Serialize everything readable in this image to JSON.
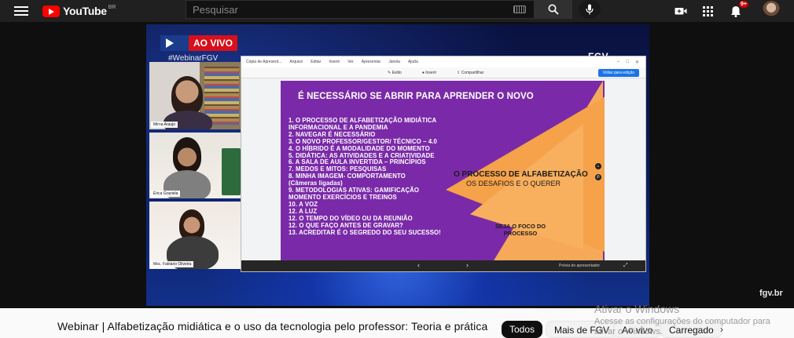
{
  "topbar": {
    "logo_text": "YouTube",
    "country": "BR",
    "search_placeholder": "Pesquisar",
    "notif_count": "9+"
  },
  "video": {
    "live_label": "AO VIVO",
    "hashtag": "#WebinarFGV",
    "brand": "FGV",
    "watermark_corner": "fgv.br",
    "participants": [
      {
        "name": "Mirna Araujo"
      },
      {
        "name": "Érica Graziela"
      },
      {
        "name": "Msc. Fabiano Oliveira"
      }
    ],
    "slides_window": {
      "menu": [
        "Cópia de Apresent...",
        "Arquivo",
        "Editar",
        "Inserir",
        "Ver",
        "Apresentar",
        "Janela",
        "Ajuda"
      ],
      "toolbar": [
        "Estilo",
        "Inserir",
        "Compartilhar"
      ],
      "share_button": "Voltar para edição",
      "footer_label": "Prévia do apresentador"
    },
    "slide": {
      "title": "É NECESSÁRIO SE ABRIR PARA APRENDER O NOVO",
      "items": [
        "1. O PROCESSO DE ALFABETIZAÇÃO MIDIÁTICA",
        "INFORMACIONAL E A PANDEMIA",
        "2. NAVEGAR É NECESSÁRIO",
        "3. O NOVO PROFESSOR/GESTOR/ TÉCNICO – 4.0",
        "4. O HÍBRIDO É A MODALIDADE DO MOMENTO",
        "5. DIDÁTICA: AS ATIVIDADES E A CRIATIVIDADE",
        "6. A SALA DE AULA INVERTIDA – PRINCÍPIOS",
        "7. MEDOS E MITOS: PESQUISAS",
        "8. MINHA IMAGEM- COMPORTAMENTO",
        "(Câmeras ligadas)",
        "9. METODOLOGIAS ATIVAS: GAMIFICAÇÃO",
        "MOMENTO EXERCÍCIOS E TREINOS",
        "10. A VOZ",
        "12. A LUZ",
        "12. O TEMPO DO VÍDEO OU DA REUNIÃO",
        "12. O QUE FAÇO ANTES DE GRAVAR?",
        "13. ACREDITAR É O SEGREDO DO SEU SUCESSO!"
      ],
      "center_title": "O PROCESSO DE ALFABETIZAÇÃO",
      "center_subtitle": "OS DESAFIOS E O QUERER",
      "focus_line1": "SEJA O FOCO DO",
      "focus_line2": "PROCESSO"
    }
  },
  "below": {
    "title": "Webinar | Alfabetização midiática e o uso da tecnologia pelo professor: Teoria e prática",
    "chips": [
      "Todos",
      "Mais de FGV",
      "Ao vivo",
      "Carregado"
    ]
  },
  "windows_watermark": {
    "line1": "Ativar o Windows",
    "line2": "Acesse as configurações do computador para ativar o Windows."
  },
  "colors": {
    "slide_purple": "#7a2aa8",
    "slide_orange": "#f5a24a",
    "live_red": "#d6101c",
    "yt_red": "#ff0000"
  }
}
